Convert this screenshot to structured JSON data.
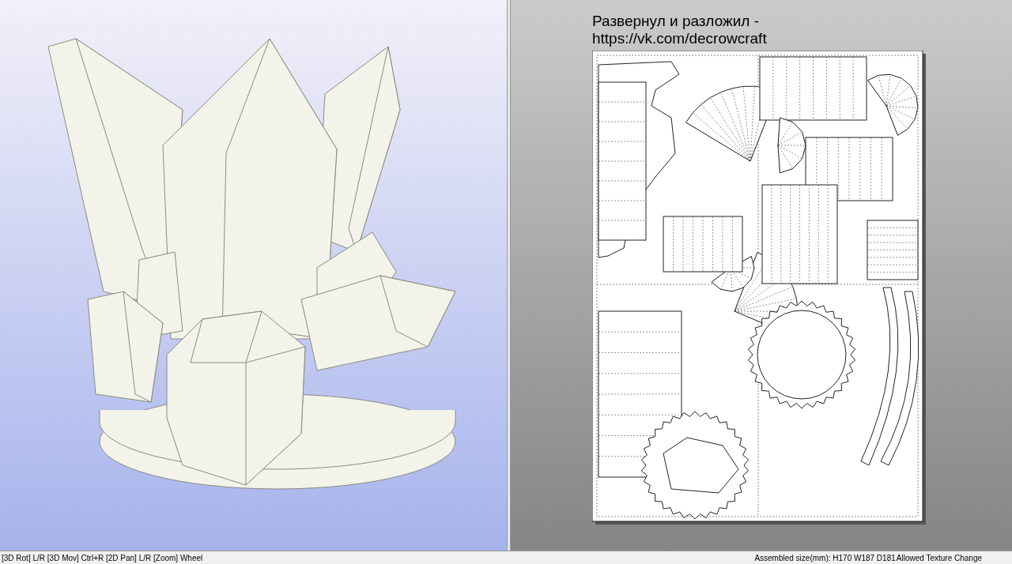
{
  "view_2d": {
    "caption_lines": [
      "Развернул и разложил -",
      "https://vk.com/decrowcraft"
    ]
  },
  "status_bar": {
    "left": "[3D Rot] L/R [3D Mov] Ctrl+R [2D Pan] L/R [Zoom] Wheel",
    "size": "Assembled size(mm): H170 W187 D181",
    "mode": "Allowed Texture Change"
  }
}
